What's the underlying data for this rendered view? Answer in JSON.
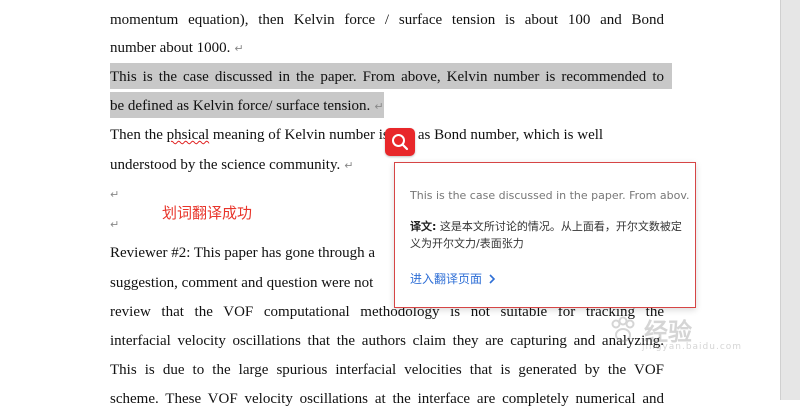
{
  "document": {
    "lines": [
      "momentum equation), then Kelvin force / surface tension is about 100 and Bond",
      "number about 1000.",
      "This is the case discussed in the paper. From above, Kelvin number is recommended to",
      "be defined as Kelvin force/ surface tension.",
      "Then the",
      "phsical",
      "meaning of Kelvin number is just as Bond number, which is well",
      "understood by the science community.",
      "Reviewer #2: This paper has gone through a",
      "suggestion, comment and question were not",
      "review that the VOF computational methodology is not suitable for tracking the",
      "interfacial velocity oscillations that the authors claim they are capturing and analyzing.",
      "This is due to the large spurious interfacial velocities that is generated by the VOF",
      "scheme. These VOF velocity oscillations at the interface are completely numerical and"
    ],
    "paragraph_mark": "↵",
    "annotation": "划词翻译成功"
  },
  "popup": {
    "source_text": "This is the case discussed in the paper. From abov...",
    "translation_label": "译文:",
    "translation_text": "这是本文所讨论的情况。从上面看，开尔文数被定义为开尔文力/表面张力",
    "link_label": "进入翻译页面"
  },
  "watermark": {
    "text": "经验",
    "sub": "jingyan.baidu.com"
  },
  "colors": {
    "accent": "#e8272a",
    "selection": "#c8c8c8",
    "link": "#2f6fd6"
  }
}
